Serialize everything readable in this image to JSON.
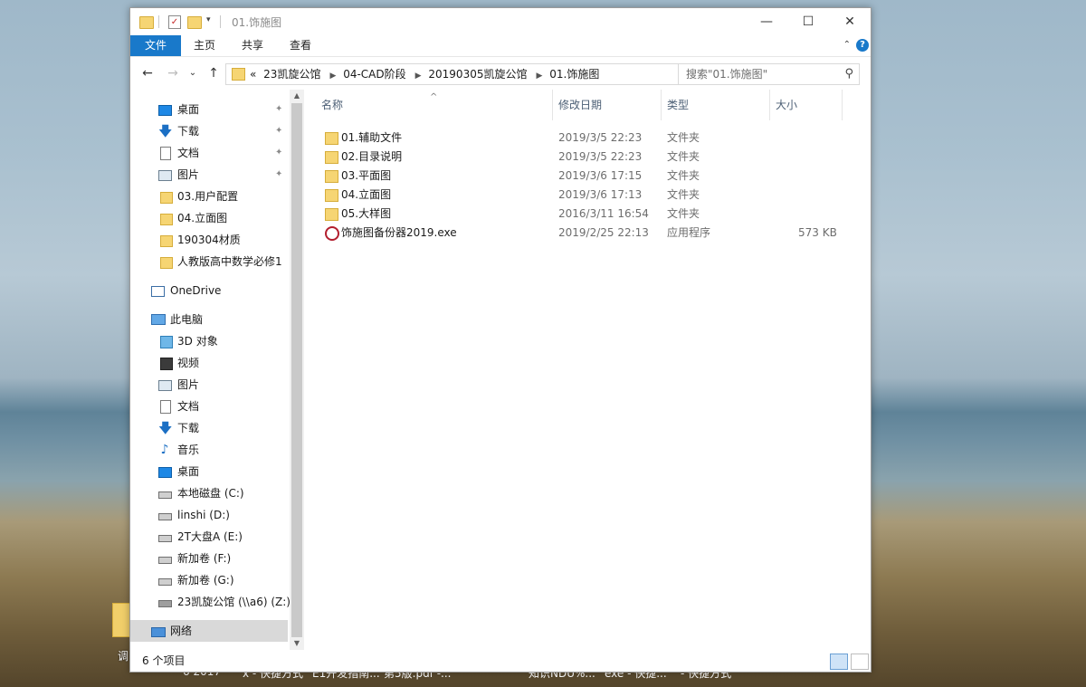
{
  "window": {
    "title": "01.饰施图",
    "minimize": "—",
    "maximize": "☐",
    "close": "✕"
  },
  "ribbon": {
    "tabs": [
      "文件",
      "主页",
      "共享",
      "查看"
    ],
    "help": "?",
    "collapse": "⌃"
  },
  "nav": {
    "back": "←",
    "forward": "→",
    "recent": "⌄",
    "up": "↑"
  },
  "address": {
    "prefix": "«",
    "crumbs": [
      "23凯旋公馆",
      "04-CAD阶段",
      "20190305凯旋公馆",
      "01.饰施图"
    ],
    "dropdown": "⌄",
    "refresh": "↻"
  },
  "search": {
    "placeholder": "搜索\"01.饰施图\""
  },
  "sidebar": {
    "quick_access": [
      {
        "label": "桌面",
        "icon": "desktop-icon",
        "pinned": true
      },
      {
        "label": "下载",
        "icon": "download-icon",
        "pinned": true
      },
      {
        "label": "文档",
        "icon": "document-icon",
        "pinned": true
      },
      {
        "label": "图片",
        "icon": "picture-icon",
        "pinned": true
      },
      {
        "label": "03.用户配置",
        "icon": "folder-icon",
        "pinned": false
      },
      {
        "label": "04.立面图",
        "icon": "folder-icon",
        "pinned": false
      },
      {
        "label": "190304材质",
        "icon": "folder-icon",
        "pinned": false
      },
      {
        "label": "人教版高中数学必修1",
        "icon": "folder-icon",
        "pinned": false
      }
    ],
    "onedrive": "OneDrive",
    "this_pc": "此电脑",
    "pc_items": [
      {
        "label": "3D 对象",
        "icon": "cube-icon"
      },
      {
        "label": "视频",
        "icon": "video-icon"
      },
      {
        "label": "图片",
        "icon": "picture-icon"
      },
      {
        "label": "文档",
        "icon": "document-icon"
      },
      {
        "label": "下载",
        "icon": "download-icon"
      },
      {
        "label": "音乐",
        "icon": "music-icon"
      },
      {
        "label": "桌面",
        "icon": "desktop-icon"
      },
      {
        "label": "本地磁盘 (C:)",
        "icon": "drive-icon"
      },
      {
        "label": "linshi (D:)",
        "icon": "drive-icon"
      },
      {
        "label": "2T大盘A (E:)",
        "icon": "drive-icon"
      },
      {
        "label": "新加卷 (F:)",
        "icon": "drive-icon"
      },
      {
        "label": "新加卷 (G:)",
        "icon": "drive-icon"
      },
      {
        "label": "23凯旋公馆 (\\\\a6) (Z:)",
        "icon": "network-drive-icon"
      }
    ],
    "network": "网络"
  },
  "columns": {
    "name": "名称",
    "modified": "修改日期",
    "type": "类型",
    "size": "大小",
    "sort_indicator": "^"
  },
  "files": [
    {
      "name": "01.辅助文件",
      "modified": "2019/3/5 22:23",
      "type": "文件夹",
      "size": "",
      "icon": "folder-icon"
    },
    {
      "name": "02.目录说明",
      "modified": "2019/3/5 22:23",
      "type": "文件夹",
      "size": "",
      "icon": "folder-icon"
    },
    {
      "name": "03.平面图",
      "modified": "2019/3/6 17:15",
      "type": "文件夹",
      "size": "",
      "icon": "folder-icon"
    },
    {
      "name": "04.立面图",
      "modified": "2019/3/6 17:13",
      "type": "文件夹",
      "size": "",
      "icon": "folder-icon"
    },
    {
      "name": "05.大样图",
      "modified": "2016/3/11 16:54",
      "type": "文件夹",
      "size": "",
      "icon": "folder-icon"
    },
    {
      "name": "饰施图备份器2019.exe",
      "modified": "2019/2/25 22:13",
      "type": "应用程序",
      "size": "573 KB",
      "icon": "exe-icon"
    }
  ],
  "status": {
    "item_count": "6 个项目"
  },
  "desktop": {
    "icon_label": "调",
    "taskbar_text": [
      "6 2017",
      "x - 快捷方式",
      "E1开发指南...",
      "第5版.pdf -...",
      "知识NDU%...",
      "exe - 快捷...",
      "- 快捷方式"
    ]
  }
}
